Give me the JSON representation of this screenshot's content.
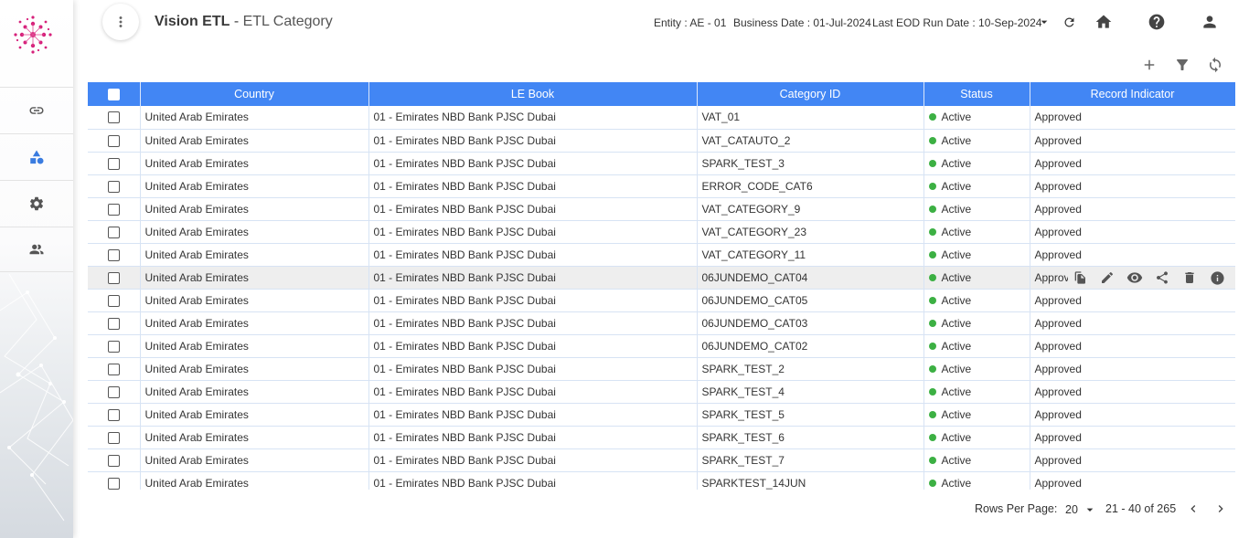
{
  "header": {
    "app_name": "Vision ETL",
    "separator": " - ",
    "page_title": "ETL Category",
    "entity": "Entity : AE - 01",
    "business_date": "Business Date : 01-Jul-2024",
    "last_eod_run_date": "Last EOD Run Date : 10-Sep-2024"
  },
  "icons": {
    "header": [
      "more-vert-icon",
      "chevron-down-icon",
      "refresh-icon",
      "home-icon",
      "help-icon",
      "account-icon"
    ],
    "toolbar": [
      "add-icon",
      "filter-icon",
      "sync-icon"
    ],
    "sidebar": [
      "link-icon",
      "shapes-icon",
      "gear-icon",
      "people-icon"
    ],
    "row_actions": [
      "copy-icon",
      "edit-icon",
      "view-icon",
      "share-icon",
      "delete-icon",
      "info-icon"
    ]
  },
  "colors": {
    "header_bar": "#4286f4",
    "status_active": "#3cb043",
    "logo": "#d6207a"
  },
  "table": {
    "columns": [
      "Country",
      "LE Book",
      "Category ID",
      "Status",
      "Record Indicator"
    ],
    "highlighted_row": 7,
    "rows": [
      {
        "country": "United Arab Emirates",
        "le_book": "01 - Emirates NBD Bank PJSC Dubai",
        "category_id": "VAT_01",
        "status": "Active",
        "record_indicator": "Approved"
      },
      {
        "country": "United Arab Emirates",
        "le_book": "01 - Emirates NBD Bank PJSC Dubai",
        "category_id": "VAT_CATAUTO_2",
        "status": "Active",
        "record_indicator": "Approved"
      },
      {
        "country": "United Arab Emirates",
        "le_book": "01 - Emirates NBD Bank PJSC Dubai",
        "category_id": "SPARK_TEST_3",
        "status": "Active",
        "record_indicator": "Approved"
      },
      {
        "country": "United Arab Emirates",
        "le_book": "01 - Emirates NBD Bank PJSC Dubai",
        "category_id": "ERROR_CODE_CAT6",
        "status": "Active",
        "record_indicator": "Approved"
      },
      {
        "country": "United Arab Emirates",
        "le_book": "01 - Emirates NBD Bank PJSC Dubai",
        "category_id": "VAT_CATEGORY_9",
        "status": "Active",
        "record_indicator": "Approved"
      },
      {
        "country": "United Arab Emirates",
        "le_book": "01 - Emirates NBD Bank PJSC Dubai",
        "category_id": "VAT_CATEGORY_23",
        "status": "Active",
        "record_indicator": "Approved"
      },
      {
        "country": "United Arab Emirates",
        "le_book": "01 - Emirates NBD Bank PJSC Dubai",
        "category_id": "VAT_CATEGORY_11",
        "status": "Active",
        "record_indicator": "Approved"
      },
      {
        "country": "United Arab Emirates",
        "le_book": "01 - Emirates NBD Bank PJSC Dubai",
        "category_id": "06JUNDEMO_CAT04",
        "status": "Active",
        "record_indicator": "Approved"
      },
      {
        "country": "United Arab Emirates",
        "le_book": "01 - Emirates NBD Bank PJSC Dubai",
        "category_id": "06JUNDEMO_CAT05",
        "status": "Active",
        "record_indicator": "Approved"
      },
      {
        "country": "United Arab Emirates",
        "le_book": "01 - Emirates NBD Bank PJSC Dubai",
        "category_id": "06JUNDEMO_CAT03",
        "status": "Active",
        "record_indicator": "Approved"
      },
      {
        "country": "United Arab Emirates",
        "le_book": "01 - Emirates NBD Bank PJSC Dubai",
        "category_id": "06JUNDEMO_CAT02",
        "status": "Active",
        "record_indicator": "Approved"
      },
      {
        "country": "United Arab Emirates",
        "le_book": "01 - Emirates NBD Bank PJSC Dubai",
        "category_id": "SPARK_TEST_2",
        "status": "Active",
        "record_indicator": "Approved"
      },
      {
        "country": "United Arab Emirates",
        "le_book": "01 - Emirates NBD Bank PJSC Dubai",
        "category_id": "SPARK_TEST_4",
        "status": "Active",
        "record_indicator": "Approved"
      },
      {
        "country": "United Arab Emirates",
        "le_book": "01 - Emirates NBD Bank PJSC Dubai",
        "category_id": "SPARK_TEST_5",
        "status": "Active",
        "record_indicator": "Approved"
      },
      {
        "country": "United Arab Emirates",
        "le_book": "01 - Emirates NBD Bank PJSC Dubai",
        "category_id": "SPARK_TEST_6",
        "status": "Active",
        "record_indicator": "Approved"
      },
      {
        "country": "United Arab Emirates",
        "le_book": "01 - Emirates NBD Bank PJSC Dubai",
        "category_id": "SPARK_TEST_7",
        "status": "Active",
        "record_indicator": "Approved"
      },
      {
        "country": "United Arab Emirates",
        "le_book": "01 - Emirates NBD Bank PJSC Dubai",
        "category_id": "SPARKTEST_14JUN",
        "status": "Active",
        "record_indicator": "Approved"
      }
    ]
  },
  "pagination": {
    "rows_per_page_label": "Rows Per Page:",
    "rows_per_page": "20",
    "range": "21 - 40 of 265"
  }
}
